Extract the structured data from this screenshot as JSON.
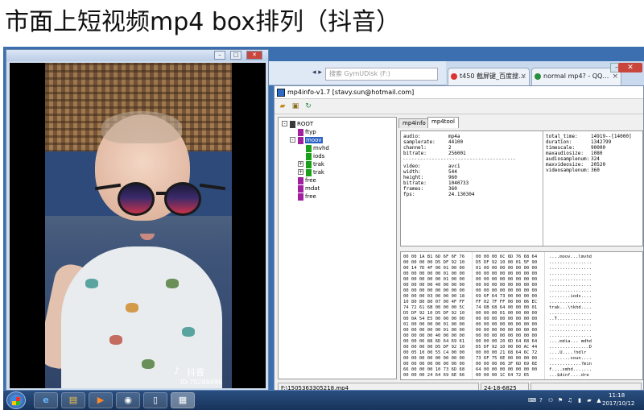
{
  "slide": {
    "title": "市面上短视频mp4 box排列（抖音）"
  },
  "explorer": {
    "search_placeholder": "搜索 GymUDisk (F:)"
  },
  "chrome": {
    "tabs": [
      {
        "label": "t450 截屏键_百度搜…"
      },
      {
        "label": "normal mp4? - QQ…"
      }
    ]
  },
  "player": {
    "watermark": "抖音",
    "user_id": "ID:70288496"
  },
  "mp4info": {
    "title": "mp4info-v1.7 [stavy.sun@hotmail.com]",
    "tabs": [
      "mp4info",
      "mp4tool"
    ],
    "tree": [
      {
        "label": "ROOT",
        "depth": 0,
        "color": "#3a3a3a",
        "expander": "-"
      },
      {
        "label": "ftyp",
        "depth": 1,
        "color": "#a020a0"
      },
      {
        "label": "moov",
        "depth": 1,
        "color": "#a020a0",
        "expander": "-",
        "selected": true
      },
      {
        "label": "mvhd",
        "depth": 2,
        "color": "#18a018"
      },
      {
        "label": "iods",
        "depth": 2,
        "color": "#18a018"
      },
      {
        "label": "trak",
        "depth": 2,
        "color": "#18a018",
        "expander": "+"
      },
      {
        "label": "trak",
        "depth": 2,
        "color": "#18a018",
        "expander": "+"
      },
      {
        "label": "free",
        "depth": 1,
        "color": "#a020a0"
      },
      {
        "label": "mdat",
        "depth": 1,
        "color": "#a020a0"
      },
      {
        "label": "free",
        "depth": 1,
        "color": "#a020a0"
      }
    ],
    "audio": [
      {
        "k": "audio:",
        "v": "mp4a"
      },
      {
        "k": "samplerate:",
        "v": "44100"
      },
      {
        "k": "channel:",
        "v": "2"
      },
      {
        "k": "bitrate:",
        "v": "256001"
      }
    ],
    "divider": "---------------------------------------",
    "video": [
      {
        "k": "video:",
        "v": "avc1"
      },
      {
        "k": "width:",
        "v": "544"
      },
      {
        "k": "height:",
        "v": "960"
      },
      {
        "k": "bitrate:",
        "v": "1040733"
      },
      {
        "k": "frames:",
        "v": "360"
      },
      {
        "k": "fps:",
        "v": "24.130304"
      }
    ],
    "stats": [
      {
        "k": "total_time:",
        "v": "14919--[14000]"
      },
      {
        "k": "duration:",
        "v": "1342799"
      },
      {
        "k": "timescale:",
        "v": "90000"
      },
      {
        "k": "maxaudiosize:",
        "v": "1080"
      },
      {
        "k": "audiosamplenum:",
        "v": "324"
      },
      {
        "k": "maxvideosize:",
        "v": "20520"
      },
      {
        "k": "videosamplenum:",
        "v": "360"
      }
    ],
    "hex_rows": [
      {
        "a": "00 00 1A B1 6D 6F 6F 76",
        "b": "00 00 00 6C 6D 76 68 64",
        "t": "....moov...lmvhd"
      },
      {
        "a": "00 00 00 00 D5 DF 92 10",
        "b": "D5 DF 92 10 00 01 5F 90",
        "t": "................"
      },
      {
        "a": "00 14 7D 4F 00 01 00 00",
        "b": "01 00 00 00 00 00 00 00",
        "t": "................"
      },
      {
        "a": "00 00 00 00 00 01 00 00",
        "b": "00 00 00 00 00 00 00 00",
        "t": "................"
      },
      {
        "a": "00 00 00 00 00 01 00 00",
        "b": "00 00 00 00 00 00 00 00",
        "t": "................"
      },
      {
        "a": "00 00 00 00 40 00 00 00",
        "b": "00 00 00 00 00 00 00 00",
        "t": "................"
      },
      {
        "a": "00 00 00 00 00 00 00 00",
        "b": "00 00 00 00 00 00 00 00",
        "t": "................"
      },
      {
        "a": "00 00 00 03 00 00 00 18",
        "b": "69 6F 64 73 00 00 00 00",
        "t": "........iods...."
      },
      {
        "a": "10 80 80 80 07 00 4F FF",
        "b": "FF 02 7F FF 00 00 06 EC",
        "t": "................"
      },
      {
        "a": "74 72 61 6B 00 00 00 5C",
        "b": "74 6B 68 64 00 00 00 01",
        "t": "trak...\\tkhd...."
      },
      {
        "a": "D5 DF 92 10 D5 DF 92 10",
        "b": "00 00 00 01 00 00 00 00",
        "t": "................"
      },
      {
        "a": "00 0A 54 E5 00 00 00 00",
        "b": "00 00 00 00 00 00 00 00",
        "t": "..T............."
      },
      {
        "a": "01 00 00 00 00 01 00 00",
        "b": "00 00 00 00 00 00 00 00",
        "t": "................"
      },
      {
        "a": "00 00 00 00 00 01 00 00",
        "b": "00 00 00 00 00 00 00 00",
        "t": "................"
      },
      {
        "a": "00 00 00 00 40 00 00 00",
        "b": "00 00 00 00 00 00 00 00",
        "t": "................"
      },
      {
        "a": "00 00 06 88 6D 64 69 61",
        "b": "00 00 00 20 6D 64 68 64",
        "t": "....mdia... mdhd"
      },
      {
        "a": "00 00 00 00 D5 DF 92 10",
        "b": "D5 DF 92 10 00 00 AC 44",
        "t": "...............D"
      },
      {
        "a": "00 05 10 00 55 C4 00 00",
        "b": "00 00 00 21 68 64 6C 72",
        "t": "....U....!hdlr"
      },
      {
        "a": "00 00 00 00 00 00 00 00",
        "b": "73 6F 75 6E 00 00 00 00",
        "t": "........soun...."
      },
      {
        "a": "00 00 00 00 00 00 00 00",
        "b": "00 00 00 06 3F 6D 69 6E",
        "t": "............?min"
      },
      {
        "a": "66 00 00 00 10 73 6D 68",
        "b": "64 00 00 00 00 00 00 00",
        "t": "f....smhd......."
      },
      {
        "a": "00 00 00 24 64 69 6E 66",
        "b": "00 00 00 1C 64 72 65",
        "t": "...$dinf....dre"
      }
    ],
    "status_path": "F:\\1505363305218.mp4",
    "status_range": "24-18-6825"
  },
  "taskbar": {
    "time": "11:18",
    "date": "2017/10/12"
  }
}
